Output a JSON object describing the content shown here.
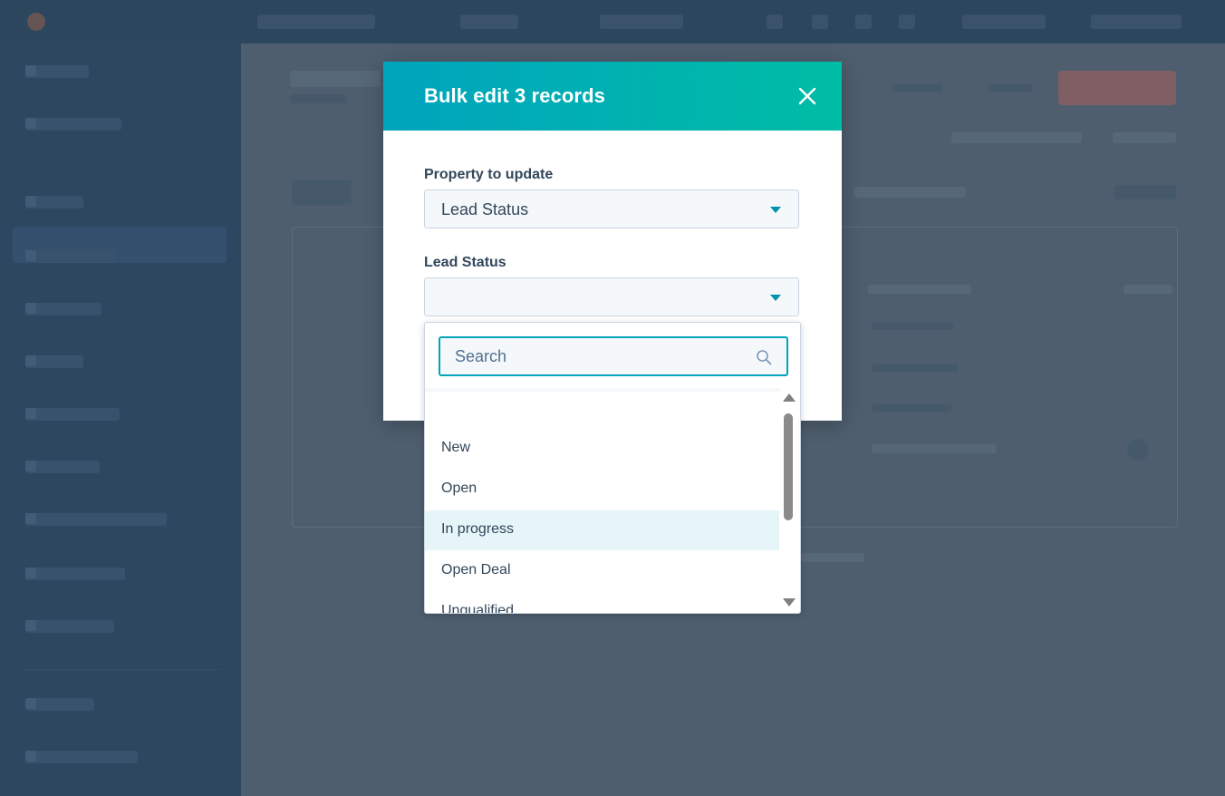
{
  "modal": {
    "title": "Bulk edit 3 records",
    "property_label": "Property to update",
    "property_value": "Lead Status",
    "status_label": "Lead Status",
    "status_value": ""
  },
  "dropdown": {
    "search_placeholder": "Search",
    "options": [
      {
        "label": ""
      },
      {
        "label": "New"
      },
      {
        "label": "Open"
      },
      {
        "label": "In progress"
      },
      {
        "label": "Open Deal"
      },
      {
        "label": "Unqualified"
      }
    ],
    "highlighted_option": "In progress"
  },
  "icons": {
    "close": "close-icon",
    "search": "search-icon",
    "caret": "chevron-down-icon"
  },
  "colors": {
    "header_gradient_start": "#00a4bd",
    "header_gradient_end": "#00bda5",
    "accent": "#00a4bd",
    "highlight": "#e5f5f8",
    "text": "#33475b"
  }
}
